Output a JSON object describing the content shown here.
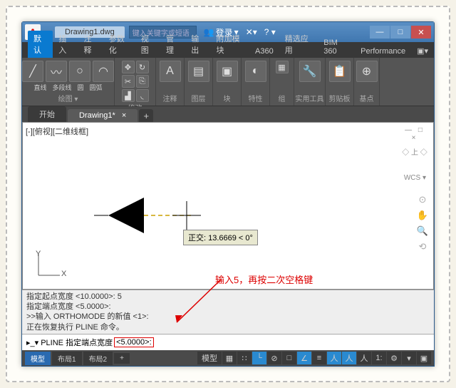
{
  "logo": "A",
  "title_tab": "Drawing1.dwg",
  "search_placeholder": "键入关键字或短语",
  "login_label": "登录",
  "ribbon_tabs": [
    "默认",
    "插入",
    "注释",
    "参数化",
    "视图",
    "管理",
    "输出",
    "附加模块",
    "A360",
    "精选应用",
    "BIM 360",
    "Performance"
  ],
  "panels": {
    "draw": {
      "label": "绘图 ▾",
      "btns": [
        "直线",
        "多段线",
        "圆",
        "圆弧"
      ]
    },
    "modify": {
      "label": "修改"
    },
    "annot": {
      "label": "注释"
    },
    "layer": {
      "label": "图层"
    },
    "block": {
      "label": "块"
    },
    "prop": {
      "label": "特性"
    },
    "group": {
      "label": "组"
    },
    "util": {
      "label": "实用工具"
    },
    "clip": {
      "label": "剪贴板"
    },
    "base": {
      "label": "基点"
    }
  },
  "draw_tabs": {
    "start": "开始",
    "d1": "Drawing1*"
  },
  "viewport_label": "[-][俯视][二维线框]",
  "cube": {
    "top": "—  □  ×",
    "face": "◇ 上 ◇"
  },
  "wcs": "WCS ▾",
  "tooltip": "正交: 13.6669 < 0°",
  "ucs": {
    "y": "Y",
    "x": "X"
  },
  "annotation": "输入5，再按二次空格键",
  "cmd_history": [
    "指定起点宽度 <10.0000>: 5",
    "指定端点宽度 <5.0000>:",
    ">>输入 ORTHOMODE 的新值 <1>:",
    "正在恢复执行 PLINE 命令。"
  ],
  "cmdline": {
    "prefix": "▸_▾ PLINE 指定端点宽度",
    "boxed": "<5.0000>:"
  },
  "status": {
    "tabs": [
      "模型",
      "布局1",
      "布局2"
    ],
    "plus": "+",
    "model": "模型"
  },
  "watermark": ""
}
